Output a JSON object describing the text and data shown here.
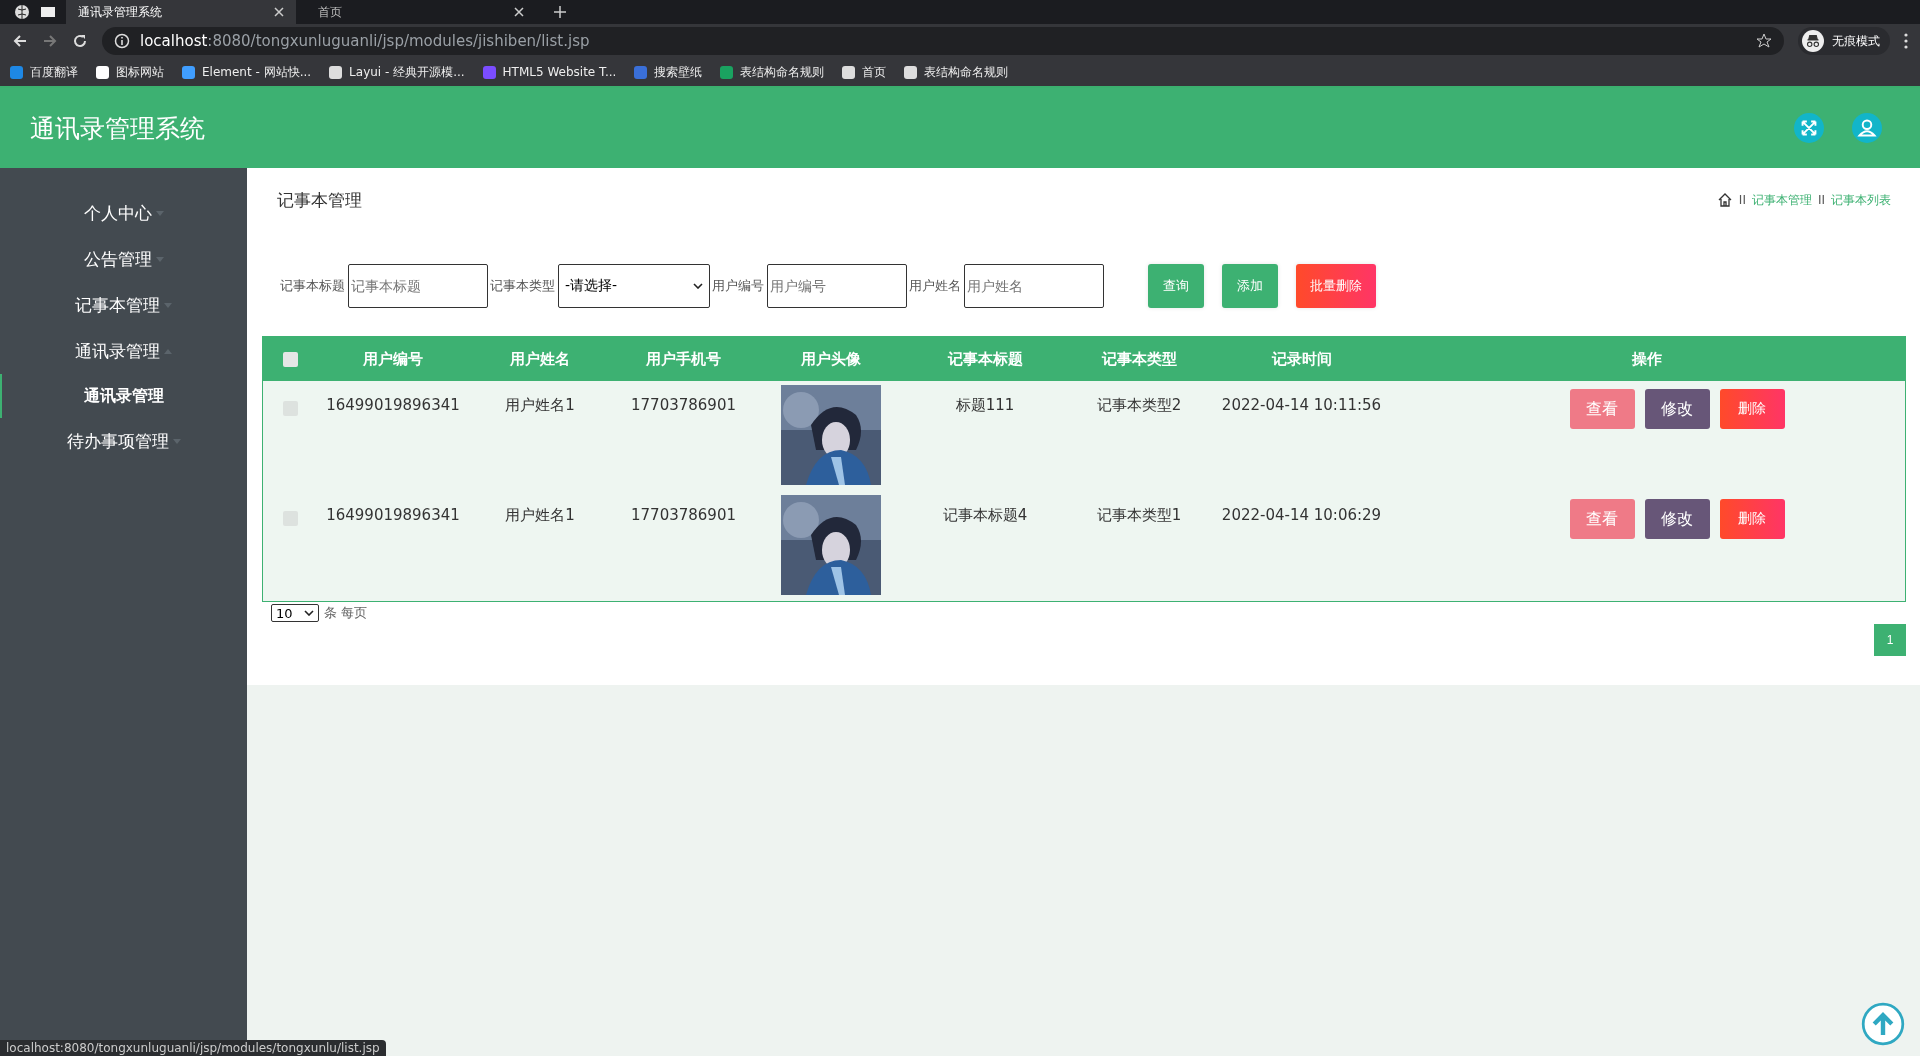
{
  "browser": {
    "tabs": [
      {
        "title": "通讯录管理系统",
        "selected": true
      },
      {
        "title": "首页",
        "selected": false
      }
    ],
    "url_host": "localhost",
    "url_rest": ":8080/tongxunluguanli/jsp/modules/jishiben/list.jsp",
    "incognito_label": "无痕模式",
    "bookmarks": [
      {
        "label": "百度翻译",
        "color": "#1e88e5"
      },
      {
        "label": "图标网站",
        "color": "#ffffff"
      },
      {
        "label": "Element - 网站快...",
        "color": "#409eff"
      },
      {
        "label": "Layui - 经典开源模...",
        "color": "#dddddd"
      },
      {
        "label": "HTML5 Website T...",
        "color": "#7b4dff"
      },
      {
        "label": "搜索壁纸",
        "color": "#3a6fd8"
      },
      {
        "label": "表结构命名规则",
        "color": "#1aa260"
      },
      {
        "label": "首页",
        "color": "#dddddd"
      },
      {
        "label": "表结构命名规则",
        "color": "#dddddd"
      }
    ],
    "status_url": "localhost:8080/tongxunluguanli/jsp/modules/tongxunlu/list.jsp"
  },
  "app": {
    "title": "通讯录管理系统"
  },
  "sidebar": {
    "items": [
      {
        "label": "个人中心",
        "expanded": false
      },
      {
        "label": "公告管理",
        "expanded": false
      },
      {
        "label": "记事本管理",
        "expanded": false
      },
      {
        "label": "通讯录管理",
        "expanded": true,
        "children": [
          {
            "label": "通讯录管理",
            "selected": true
          }
        ]
      },
      {
        "label": "待办事项管理",
        "expanded": false
      }
    ]
  },
  "page": {
    "title": "记事本管理",
    "breadcrumb": [
      {
        "separator": "II",
        "label": "记事本管理"
      },
      {
        "separator": "II",
        "label": "记事本列表"
      }
    ]
  },
  "search": {
    "fields": [
      {
        "kind": "input",
        "label": "记事本标题",
        "placeholder": "记事本标题"
      },
      {
        "kind": "select",
        "label": "记事本类型",
        "value": "-请选择-"
      },
      {
        "kind": "input",
        "label": "用户编号",
        "placeholder": "用户编号"
      },
      {
        "kind": "input",
        "label": "用户姓名",
        "placeholder": "用户姓名"
      }
    ],
    "buttons": [
      {
        "kind": "primary",
        "label": "查询"
      },
      {
        "kind": "primary",
        "label": "添加"
      },
      {
        "kind": "danger",
        "label": "批量删除"
      }
    ]
  },
  "table": {
    "select_all_checked": false,
    "columns": [
      "用户编号",
      "用户姓名",
      "用户手机号",
      "用户头像",
      "记事本标题",
      "记事本类型",
      "记录时间",
      "操作"
    ],
    "rows": [
      {
        "checked": false,
        "cells": [
          "16499019896341",
          "用户姓名1",
          "17703786901",
          {
            "kind": "picture"
          },
          "标题111",
          "记事本类型2",
          "2022-04-14 10:11:56"
        ],
        "actions": [
          "查看",
          "修改",
          "删除"
        ]
      },
      {
        "checked": false,
        "cells": [
          "16499019896341",
          "用户姓名1",
          "17703786901",
          {
            "kind": "picture"
          },
          "记事本标题4",
          "记事本类型1",
          "2022-04-14 10:06:29"
        ],
        "actions": [
          "查看",
          "修改",
          "删除"
        ]
      }
    ]
  },
  "pagination": {
    "page_size": "10",
    "per_page_label": "条 每页",
    "pages": [
      {
        "label": "1",
        "selected": true
      }
    ]
  }
}
